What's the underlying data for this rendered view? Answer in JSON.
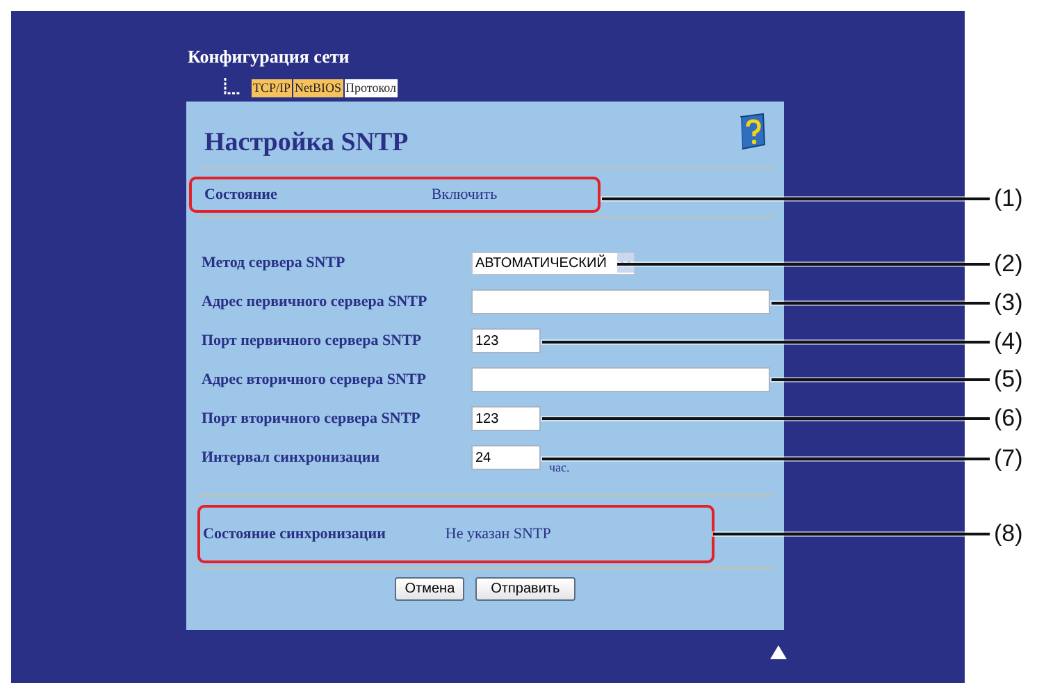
{
  "heading": "Конфигурация сети",
  "tabs": [
    {
      "label": "TCP/IP",
      "selected": false
    },
    {
      "label": "NetBIOS",
      "selected": false
    },
    {
      "label": "Протокол",
      "selected": true
    }
  ],
  "panel": {
    "title": "Настройка SNTP",
    "status": {
      "label": "Состояние",
      "value": "Включить"
    },
    "fields": [
      {
        "kind": "select",
        "label": "Метод сервера SNTP",
        "value": "АВТОМАТИЧЕСКИЙ"
      },
      {
        "kind": "wide",
        "label": "Адрес первичного сервера SNTP"
      },
      {
        "kind": "short",
        "label": "Порт первичного сервера SNTP",
        "value": "123"
      },
      {
        "kind": "wide",
        "label": "Адрес вторичного сервера SNTP"
      },
      {
        "kind": "short",
        "label": "Порт вторичного сервера SNTP",
        "value": "123"
      },
      {
        "kind": "short",
        "label": "Интервал синхронизации",
        "value": "24",
        "unit": "час."
      }
    ],
    "sync_status": {
      "label": "Состояние синхронизации",
      "value": "Не указан SNTP"
    },
    "buttons": [
      "Отмена",
      "Отправить"
    ]
  },
  "callouts": [
    "(1)",
    "(2)",
    "(3)",
    "(4)",
    "(5)",
    "(6)",
    "(7)",
    "(8)"
  ]
}
